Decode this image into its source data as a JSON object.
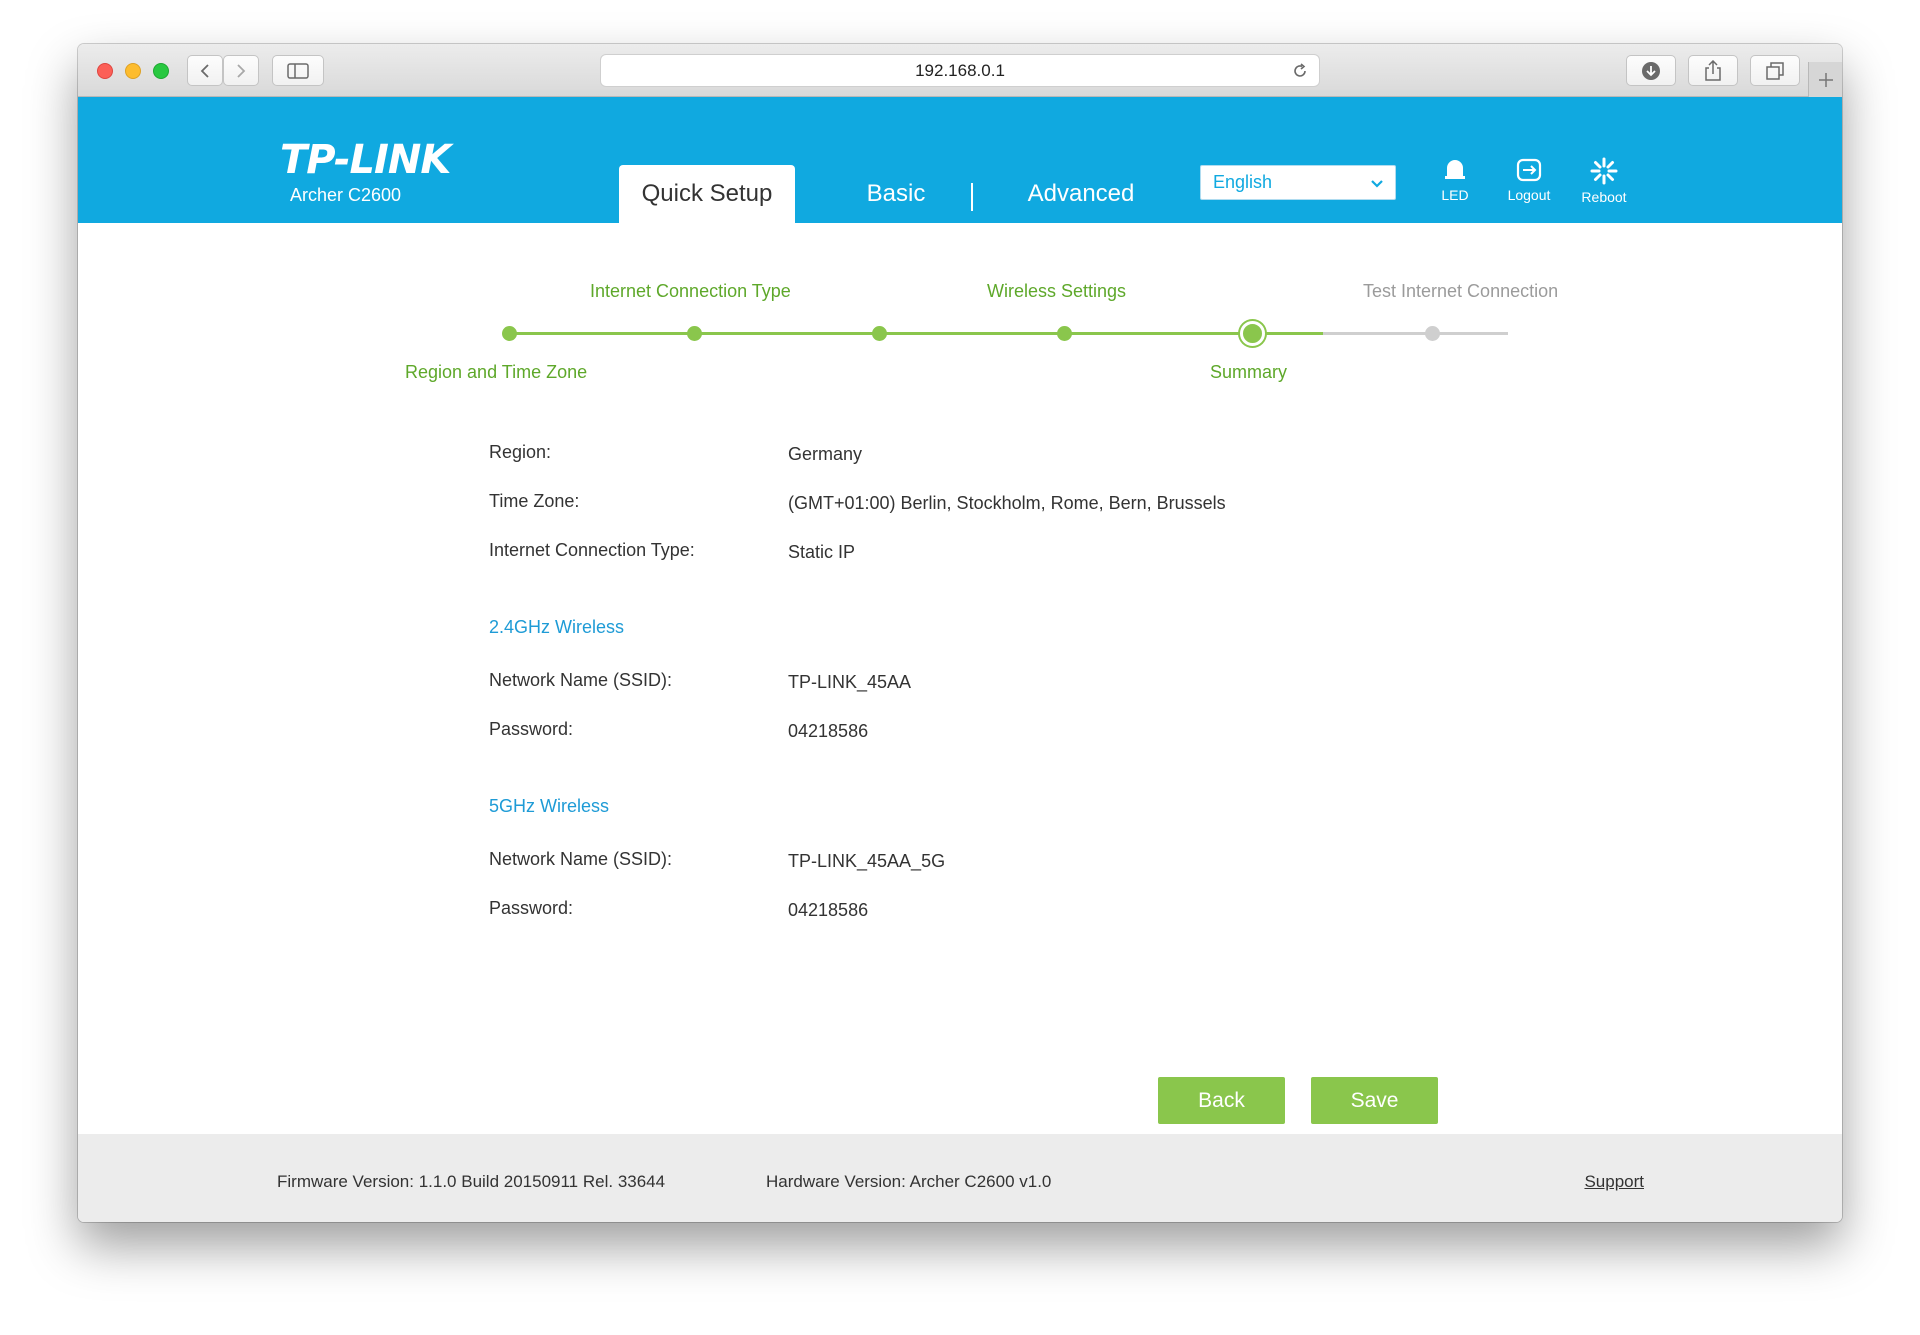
{
  "browser": {
    "url": "192.168.0.1"
  },
  "header": {
    "logo": "TP-LINK",
    "model": "Archer C2600",
    "tabs": {
      "quick_setup": "Quick Setup",
      "basic": "Basic",
      "advanced": "Advanced"
    },
    "language": "English",
    "icons": {
      "led": "LED",
      "logout": "Logout",
      "reboot": "Reboot"
    }
  },
  "progress": {
    "steps_top": [
      "Internet Connection Type",
      "Wireless Settings",
      "Test Internet Connection"
    ],
    "steps_bottom": [
      "Region and Time Zone",
      "Summary"
    ]
  },
  "summary": {
    "region_label": "Region:",
    "region_value": "Germany",
    "timezone_label": "Time Zone:",
    "timezone_value": "(GMT+01:00) Berlin, Stockholm, Rome, Bern, Brussels",
    "conn_type_label": "Internet Connection Type:",
    "conn_type_value": "Static IP",
    "wireless_24": {
      "title": "2.4GHz Wireless",
      "ssid_label": "Network Name (SSID):",
      "ssid_value": "TP-LINK_45AA",
      "password_label": "Password:",
      "password_value": "04218586"
    },
    "wireless_5": {
      "title": "5GHz Wireless",
      "ssid_label": "Network Name (SSID):",
      "ssid_value": "TP-LINK_45AA_5G",
      "password_label": "Password:",
      "password_value": "04218586"
    }
  },
  "buttons": {
    "back": "Back",
    "save": "Save"
  },
  "footer": {
    "firmware": "Firmware Version: 1.1.0 Build 20150911 Rel. 33644",
    "hardware": "Hardware Version: Archer C2600 v1.0",
    "support": "Support"
  },
  "colors": {
    "brand_blue": "#10a9e0",
    "step_green": "#8ac64c"
  }
}
